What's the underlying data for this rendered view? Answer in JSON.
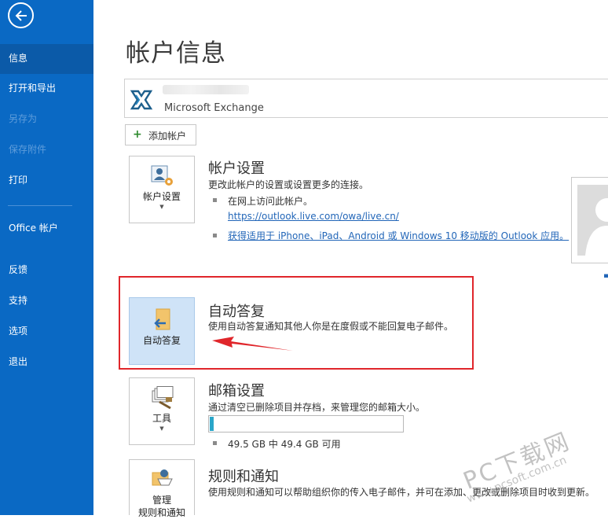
{
  "sidebar": {
    "items": [
      {
        "label": "信息"
      },
      {
        "label": "打开和导出"
      },
      {
        "label": "另存为"
      },
      {
        "label": "保存附件"
      },
      {
        "label": "打印"
      },
      {
        "label": "Office 帐户"
      },
      {
        "label": "反馈"
      },
      {
        "label": "支持"
      },
      {
        "label": "选项"
      },
      {
        "label": "退出"
      }
    ],
    "active_index": 0,
    "accent_color": "#0a69c4"
  },
  "main": {
    "title": "帐户信息",
    "account": {
      "type": "Microsoft Exchange",
      "icon": "exchange-icon"
    },
    "add_account_label": "添加帐户",
    "account_settings": {
      "tile_label": "帐户设置",
      "title": "帐户设置",
      "desc": "更改此帐户的设置或设置更多的连接。",
      "bullet1": "在网上访问此帐户。",
      "link1": "https://outlook.live.com/owa/live.cn/",
      "link2": "获得适用于 iPhone、iPad、Android 或 Windows 10 移动版的 Outlook 应用。"
    },
    "auto_reply": {
      "tile_label": "自动答复",
      "title": "自动答复",
      "desc": "使用自动答复通知其他人你是在度假或不能回复电子邮件。"
    },
    "mailbox": {
      "tile_label": "工具",
      "title": "邮箱设置",
      "desc": "通过清空已删除项目并存档，来管理您的邮箱大小。",
      "usage_text": "49.5 GB 中 49.4 GB 可用",
      "used_fraction": 0.02
    },
    "rules": {
      "tile_label": "管理",
      "tile_label2": "规则和通知",
      "title": "规则和通知",
      "desc": "使用规则和通知可以帮助组织你的传入电子邮件，并可在添加、更改或删除项目时收到更新。"
    }
  },
  "watermark": {
    "text": "PC下载网",
    "sub": "www.pcsoft.com.cn"
  }
}
